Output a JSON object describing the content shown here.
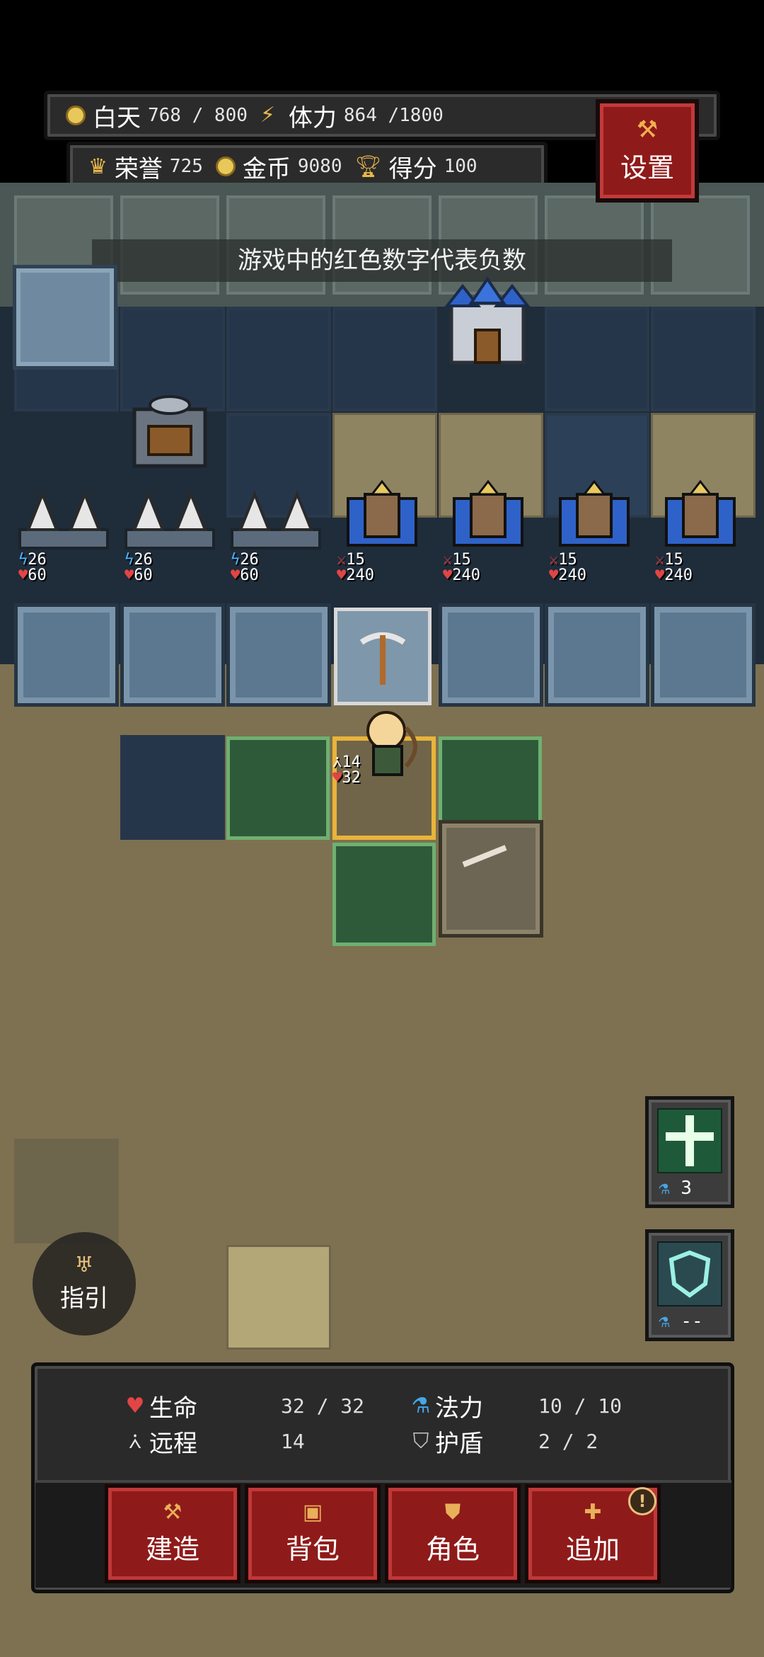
{
  "hud": {
    "daytime_label": "白天",
    "daytime_value": "768 / 800",
    "stamina_label": "体力",
    "stamina_value": "864 /1800",
    "honor_label": "荣誉",
    "honor_value": "725",
    "gold_label": "金币",
    "gold_value": "9080",
    "score_label": "得分",
    "score_value": "100"
  },
  "settings_button": {
    "label": "设置"
  },
  "hint": "游戏中的红色数字代表负数",
  "units": [
    {
      "type": "tower",
      "a": "26",
      "b": "60"
    },
    {
      "type": "tower",
      "a": "26",
      "b": "60"
    },
    {
      "type": "tower",
      "a": "26",
      "b": "60"
    },
    {
      "type": "knight",
      "a": "15",
      "b": "240"
    },
    {
      "type": "knight",
      "a": "15",
      "b": "240"
    },
    {
      "type": "knight",
      "a": "15",
      "b": "240"
    },
    {
      "type": "knight",
      "a": "15",
      "b": "240"
    }
  ],
  "hero": {
    "a": "14",
    "b": "32"
  },
  "skills": [
    {
      "name": "heal-cross",
      "cost": "3"
    },
    {
      "name": "shield",
      "cost": "--"
    }
  ],
  "guide_button": {
    "label": "指引"
  },
  "panel": {
    "hp_label": "生命",
    "hp_value": "32 / 32",
    "ranged_label": "远程",
    "ranged_value": "14",
    "mana_label": "法力",
    "mana_value": "10 / 10",
    "shield_label": "护盾",
    "shield_value": "2 / 2"
  },
  "actions": {
    "build": "建造",
    "bag": "背包",
    "character": "角色",
    "add": "追加",
    "add_badge": "!"
  },
  "colors": {
    "button_red": "#8f1a1a",
    "gold": "#e9b84a",
    "mana_blue": "#46a6e8",
    "hp_red": "#e14545"
  }
}
